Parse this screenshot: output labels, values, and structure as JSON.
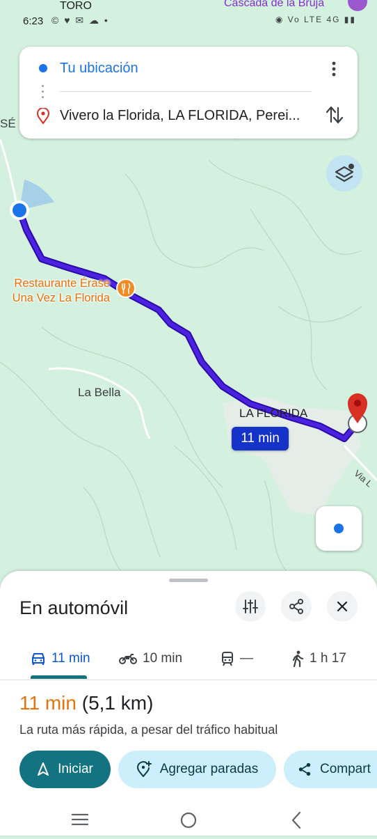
{
  "status_bar": {
    "time": "6:23",
    "notif_icons": "© ♥ ✉ ☁ •",
    "right_icons": "◉ Vo LTE 4G ▮▮"
  },
  "map": {
    "labels": {
      "toro": "TORO",
      "cascada": "Cascada de la Bruja",
      "se": "SÉ",
      "restaurant_line1": "Restaurante Érase",
      "restaurant_line2": "Una Vez La Florida",
      "la_bella": "La Bella",
      "la_florida": "LA FLORIDA",
      "via": "Via L"
    },
    "eta_badge": "11 min"
  },
  "search": {
    "origin": "Tu ubicación",
    "destination": "Vivero la Florida, LA FLORIDA, Perei..."
  },
  "sheet": {
    "title": "En automóvil",
    "modes": [
      {
        "icon": "car-icon",
        "label": "11 min",
        "active": true
      },
      {
        "icon": "motorcycle-icon",
        "label": "10 min",
        "active": false
      },
      {
        "icon": "train-icon",
        "label": "—",
        "active": false
      },
      {
        "icon": "walk-icon",
        "label": "1 h 17",
        "active": false
      }
    ],
    "summary_time": "11 min",
    "summary_distance": "(5,1 km)",
    "description": "La ruta más rápida, a pesar del tráfico habitual",
    "buttons": {
      "start": "Iniciar",
      "add_stops": "Agregar paradas",
      "share": "Compart"
    }
  },
  "colors": {
    "map_bg": "#d4f0de",
    "route": "#3e11d8",
    "accent": "#137380",
    "origin": "#1a73e8",
    "destination_pin": "#d93025",
    "eta_time": "#e8710a"
  }
}
